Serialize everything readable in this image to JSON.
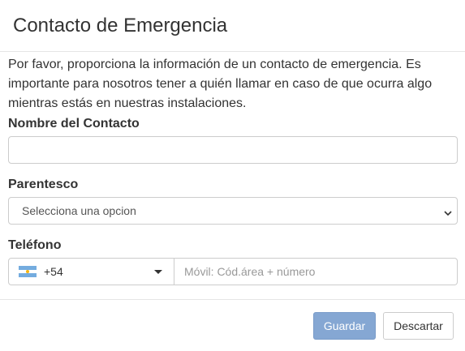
{
  "modal": {
    "title": "Contacto de Emergencia",
    "intro": "Por favor, proporciona la información de un contacto de emergencia. Es importante para nosotros tener a quién llamar en caso de que ocurra algo mientras estás en nuestras instalaciones."
  },
  "form": {
    "name": {
      "label": "Nombre del Contacto",
      "value": ""
    },
    "relationship": {
      "label": "Parentesco",
      "selected": "Selecciona una opcion"
    },
    "phone": {
      "label": "Teléfono",
      "country_flag": "argentina-flag-icon",
      "country_code": "+54",
      "placeholder": "Móvil: Cód.área + número",
      "value": ""
    }
  },
  "footer": {
    "save_label": "Guardar",
    "discard_label": "Descartar"
  },
  "colors": {
    "primary_button": "#85a7d3",
    "border": "#cccccc"
  }
}
